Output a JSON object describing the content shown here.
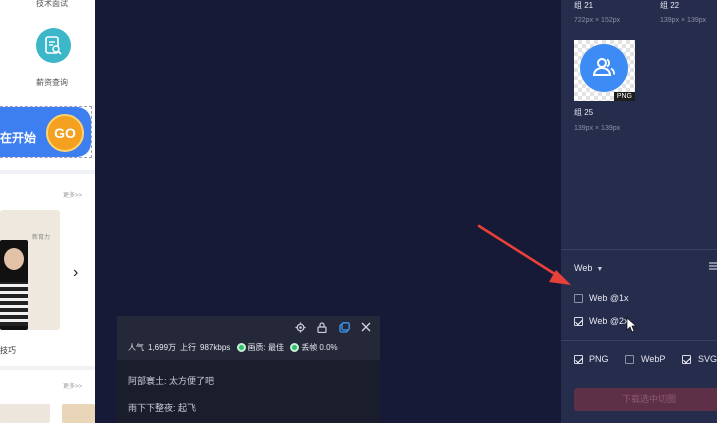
{
  "left_panel": {
    "top_text": "技术面试",
    "salary_label": "薪资查询",
    "banner_text": "在开始",
    "go_label": "GO",
    "more_1": "更多>>",
    "card_sign": "新育力",
    "tips_label": "技巧",
    "more_2": "更多>>"
  },
  "live_panel": {
    "toolbar_icons": [
      "gear-icon",
      "lock-icon",
      "popout-icon",
      "close-icon"
    ],
    "stats": {
      "popularity_label": "人气",
      "popularity_value": "1,699万",
      "upload_label": "上行",
      "upload_value": "987kbps",
      "quality_label": "画质: 最佳",
      "drop_label": "丢帧 0.0%"
    },
    "messages": [
      "阿部寰土: 太方便了吧",
      "雨下下整夜: 起飞"
    ]
  },
  "right_panel": {
    "assets": [
      {
        "name": "组 21",
        "size": "722px × 152px"
      },
      {
        "name": "组 22",
        "size": "139px × 139px"
      },
      {
        "name": "组 25",
        "size": "139px × 139px",
        "badge": "PNG"
      }
    ],
    "platform_select": "Web",
    "scales": [
      {
        "label": "Web @1x",
        "checked": false
      },
      {
        "label": "Web @2x",
        "checked": true
      }
    ],
    "formats": [
      {
        "label": "PNG",
        "checked": true
      },
      {
        "label": "WebP",
        "checked": false
      },
      {
        "label": "SVG",
        "checked": true
      }
    ],
    "download_label": "下载选中切图"
  },
  "colors": {
    "background": "#161a36",
    "right_panel": "#262c4c",
    "annotation_arrow": "#e8413a",
    "asset_blue": "#3d8cf5"
  }
}
